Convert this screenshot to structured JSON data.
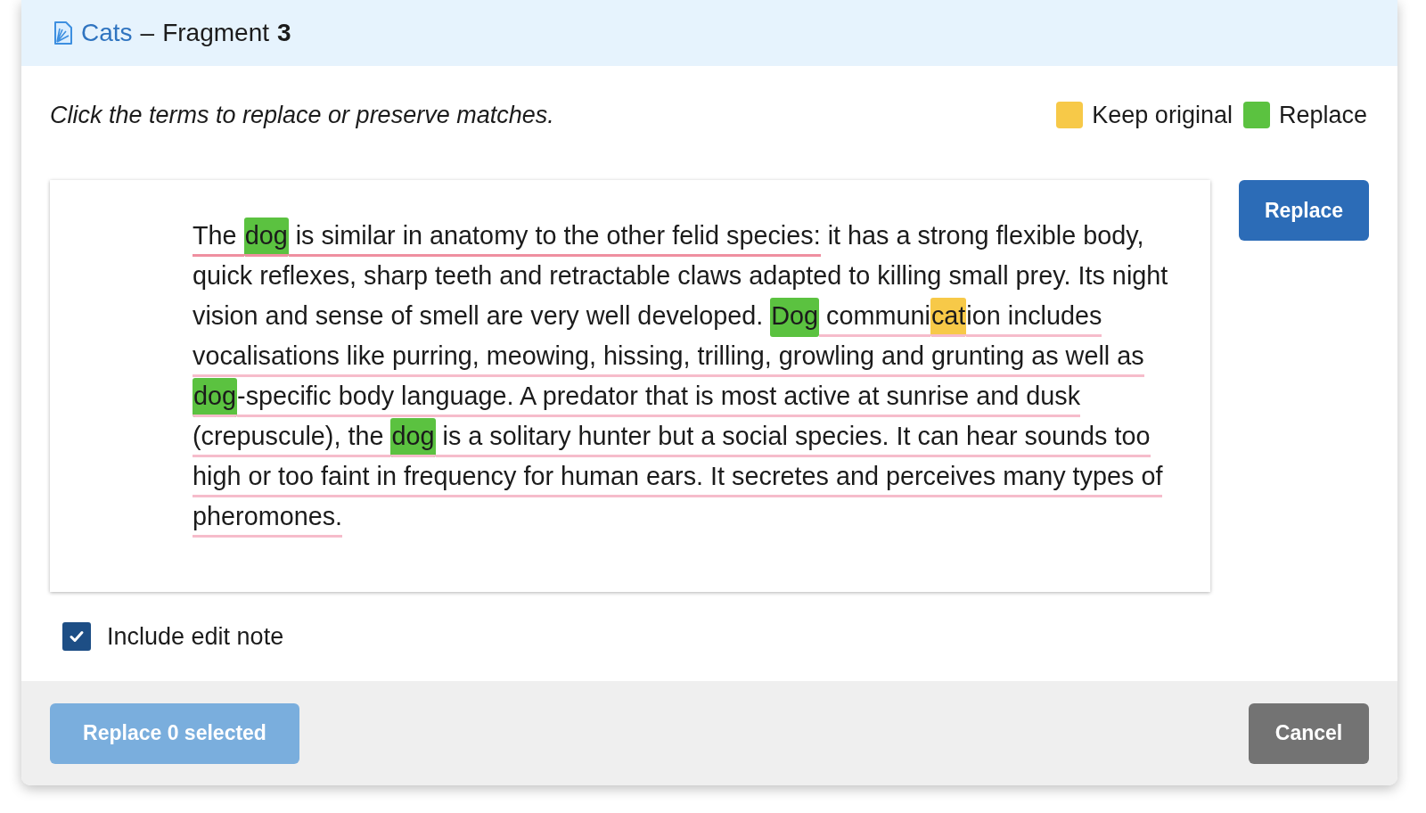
{
  "header": {
    "link": "Cats",
    "separator": "–",
    "title": "Fragment",
    "number": "3"
  },
  "instruction": "Click the terms to replace or preserve matches.",
  "legend": [
    {
      "label": "Keep original",
      "color": "#f7c948"
    },
    {
      "label": "Replace",
      "color": "#5bc240"
    }
  ],
  "passage": [
    {
      "text": "The ",
      "kind": "plain",
      "underlined": true,
      "hovered": true
    },
    {
      "text": "dog",
      "kind": "replace",
      "underlined": true,
      "hovered": true
    },
    {
      "text": " is similar in anatomy to the other felid species:",
      "kind": "plain",
      "underlined": true,
      "hovered": true
    },
    {
      "text": " it has a strong flexible body, quick reflexes, sharp teeth and retractable claws adapted to killing small prey. Its night vision and sense of smell are very well developed. ",
      "kind": "plain",
      "underlined": false
    },
    {
      "text": "Dog",
      "kind": "replace",
      "underlined": false
    },
    {
      "text": " communi",
      "kind": "plain",
      "underlined": true,
      "hovered": false
    },
    {
      "text": "cat",
      "kind": "keep",
      "underlined": true,
      "hovered": false
    },
    {
      "text": "ion includes vocalisations like purring, meowing, hissing, trilling, growling and grunting as well as ",
      "kind": "plain",
      "underlined": true,
      "hovered": false
    },
    {
      "text": "dog",
      "kind": "replace",
      "underlined": true,
      "hovered": false
    },
    {
      "text": "-specific body language.",
      "kind": "plain",
      "underlined": true,
      "hovered": false
    },
    {
      "text": " A predator that is most active at sunrise and dusk (crepuscule), the ",
      "kind": "plain",
      "underlined": true,
      "hovered": false
    },
    {
      "text": "dog",
      "kind": "replace",
      "underlined": true,
      "hovered": false
    },
    {
      "text": " is a solitary hunter but a social species. It can hear sounds too high or too faint in frequency for human ears. It secretes and perceives many types of pheromones.",
      "kind": "plain",
      "underlined": true,
      "hovered": false
    }
  ],
  "replace_button": "Replace",
  "edit_note": {
    "label": "Include edit note",
    "checked": true
  },
  "footer": {
    "replace_selected": {
      "label": "Replace 0 selected",
      "disabled": true
    },
    "cancel": "Cancel"
  }
}
